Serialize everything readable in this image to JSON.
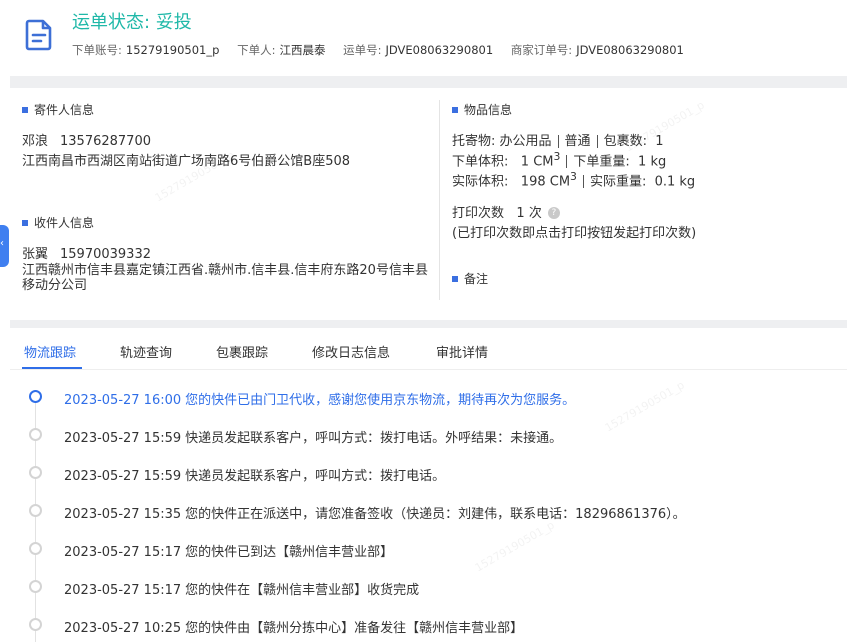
{
  "header": {
    "status_label": "运单状态:",
    "status_value": "妥投",
    "meta": [
      {
        "label": "下单账号:",
        "value": "15279190501_p"
      },
      {
        "label": "下单人:",
        "value": "江西晨泰"
      },
      {
        "label": "运单号:",
        "value": "JDVE08063290801"
      },
      {
        "label": "商家订单号:",
        "value": "JDVE08063290801"
      }
    ]
  },
  "sender": {
    "title": "寄件人信息",
    "name": "邓浪",
    "phone": "13576287700",
    "address": "江西南昌市西湖区南站街道广场南路6号伯爵公馆B座508"
  },
  "receiver": {
    "title": "收件人信息",
    "name": "张翼",
    "phone": "15970039332",
    "address": "江西赣州市信丰县嘉定镇江西省.赣州市.信丰县.信丰府东路20号信丰县移动分公司"
  },
  "goods": {
    "title": "物品信息",
    "item_label": "托寄物:",
    "item_value": "办公用品",
    "type_value": "普通",
    "pkg_label": "包裹数:",
    "pkg_value": "1",
    "order_vol_label": "下单体积:",
    "order_vol_value": "1 CM",
    "order_wt_label": "下单重量:",
    "order_wt_value": "1 kg",
    "actual_vol_label": "实际体积:",
    "actual_vol_value": "198 CM",
    "actual_wt_label": "实际重量:",
    "actual_wt_value": "0.1 kg",
    "unit_sup": "3",
    "print_label": "打印次数",
    "print_value": "1 次",
    "print_note": "(已打印次数即点击打印按钮发起打印次数)"
  },
  "remarks": {
    "title": "备注"
  },
  "side_tab": {
    "glyph": "‹"
  },
  "help_icon": {
    "glyph": "?"
  },
  "tabs": [
    {
      "label": "物流跟踪"
    },
    {
      "label": "轨迹查询"
    },
    {
      "label": "包裹跟踪"
    },
    {
      "label": "修改日志信息"
    },
    {
      "label": "审批详情"
    }
  ],
  "timeline": [
    {
      "time": "2023-05-27 16:00",
      "text": "您的快件已由门卫代收，感谢您使用京东物流，期待再次为您服务。"
    },
    {
      "time": "2023-05-27 15:59",
      "text": "快递员发起联系客户，呼叫方式：拨打电话。外呼结果：未接通。"
    },
    {
      "time": "2023-05-27 15:59",
      "text": "快递员发起联系客户，呼叫方式：拨打电话。"
    },
    {
      "time": "2023-05-27 15:35",
      "text": "您的快件正在派送中，请您准备签收（快递员：刘建伟，联系电话：18296861376）。"
    },
    {
      "time": "2023-05-27 15:17",
      "text": "您的快件已到达【赣州信丰营业部】"
    },
    {
      "time": "2023-05-27 15:17",
      "text": "您的快件在【赣州信丰营业部】收货完成"
    },
    {
      "time": "2023-05-27 10:25",
      "text": "您的快件由【赣州分拣中心】准备发往【赣州信丰营业部】"
    }
  ],
  "watermark": "15279190501_p",
  "colors": {
    "accent": "#2f6ee8",
    "status": "#1fb8a8",
    "section_mark": "#3b6fe0"
  }
}
